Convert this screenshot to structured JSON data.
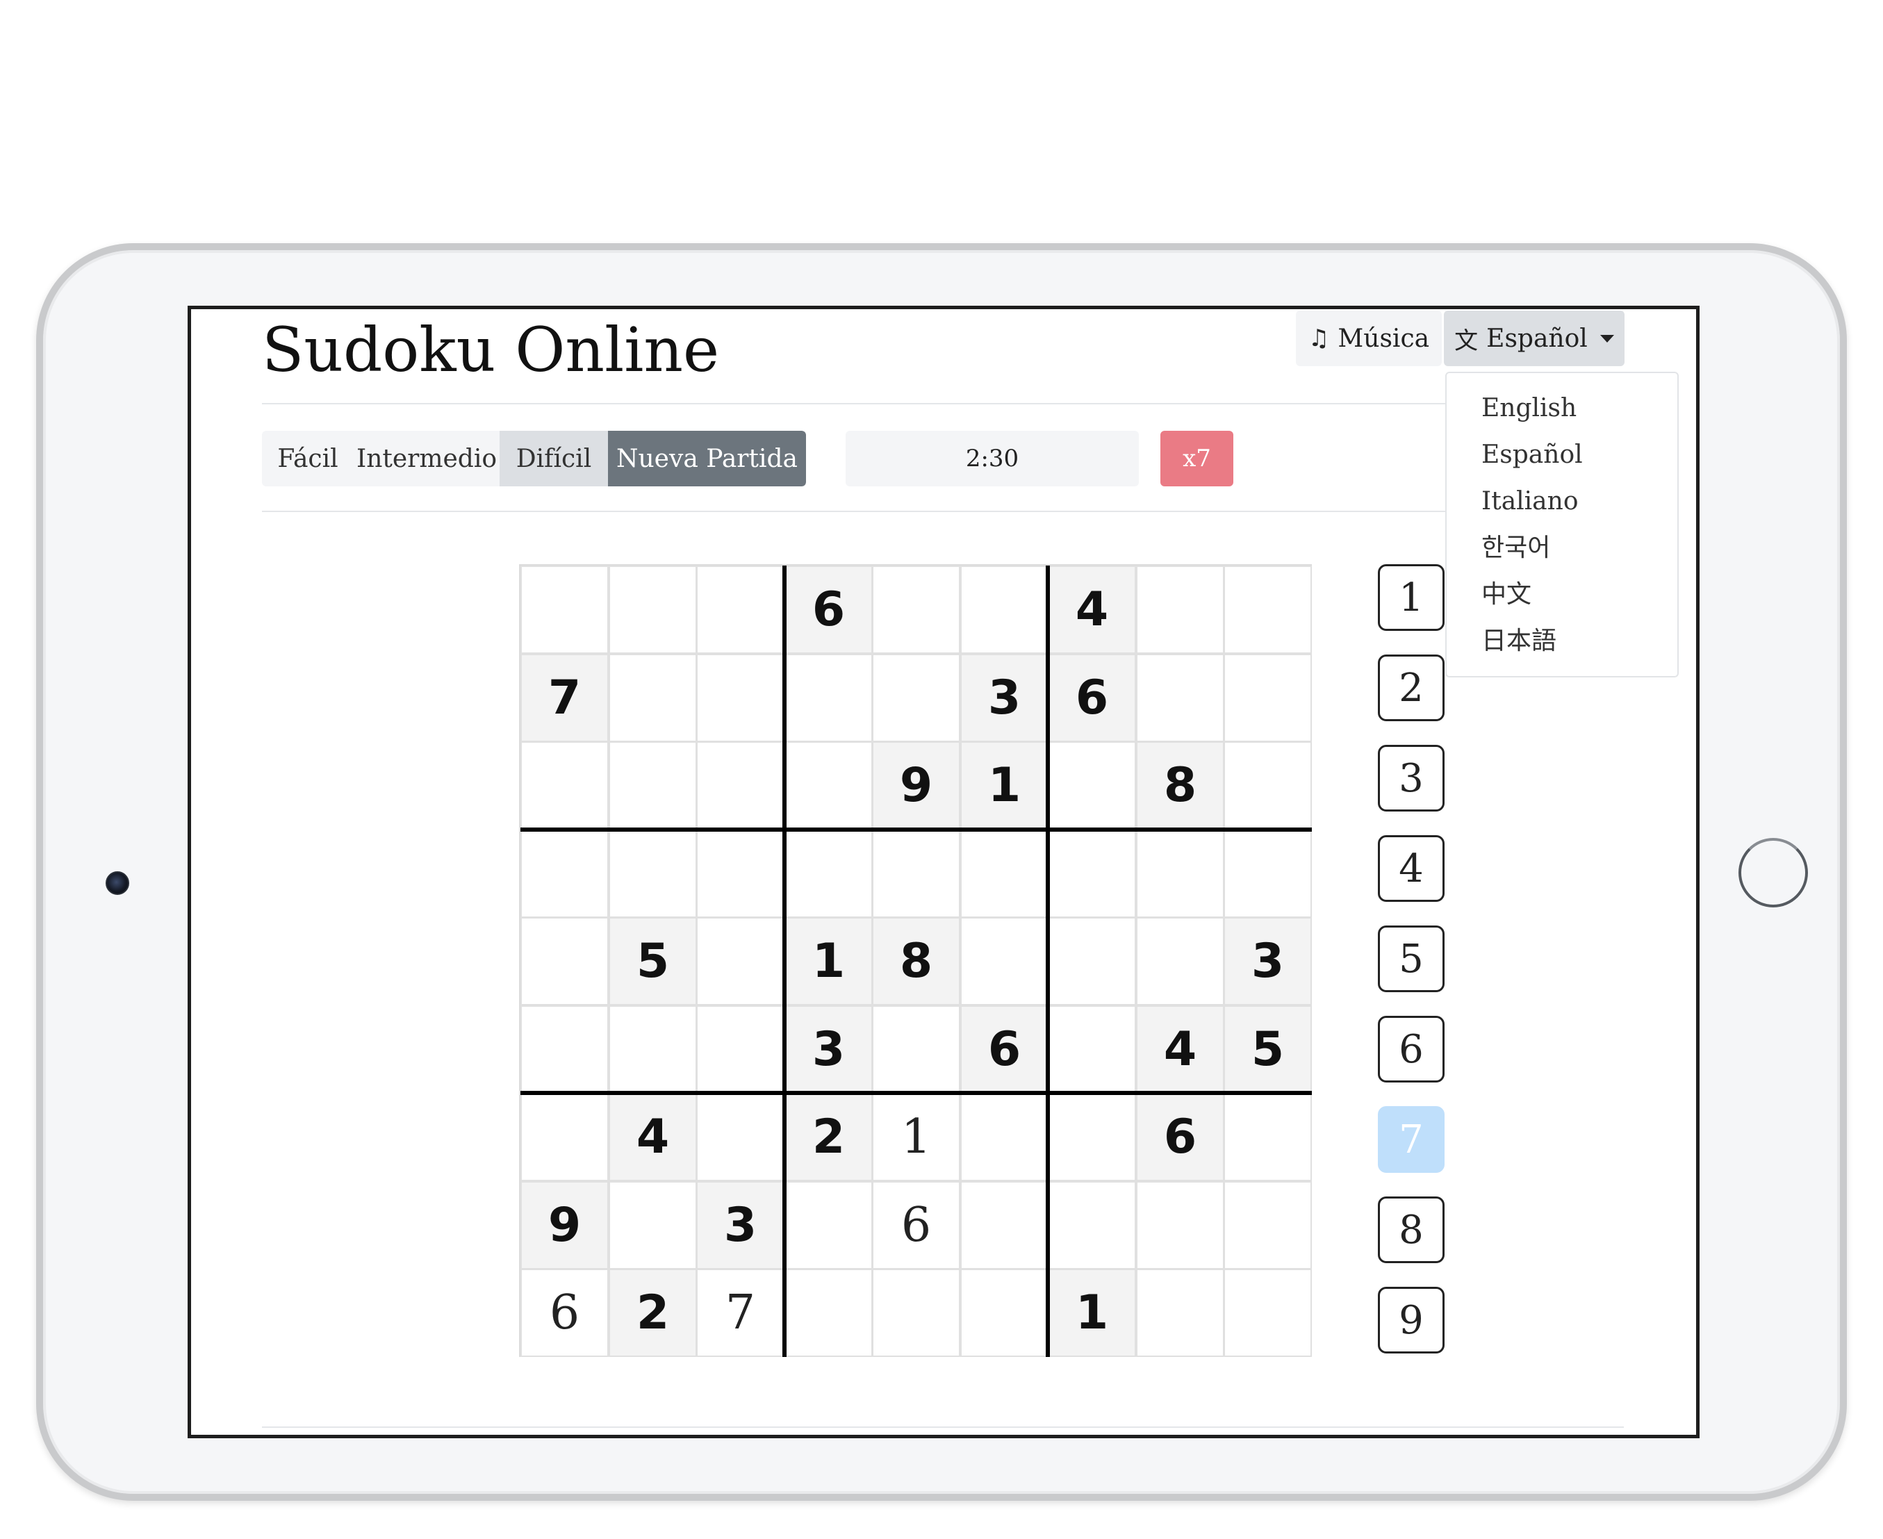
{
  "app": {
    "title": "Sudoku Online"
  },
  "header": {
    "music_label": "Música",
    "language_label": "Español"
  },
  "language_menu": {
    "items": [
      "English",
      "Español",
      "Italiano",
      "한국어",
      "中文",
      "日本語"
    ]
  },
  "toolbar": {
    "difficulty": [
      "Fácil",
      "Intermedio",
      "Difícil"
    ],
    "selected_difficulty": "Difícil",
    "new_game_label": "Nueva Partida",
    "timer": "2:30",
    "mistakes": "x7"
  },
  "board": {
    "rows": [
      [
        "",
        "",
        "",
        "6",
        "",
        "",
        "4",
        "",
        ""
      ],
      [
        "7",
        "",
        "",
        "",
        "",
        "3",
        "6",
        "",
        ""
      ],
      [
        "",
        "",
        "",
        "",
        "9",
        "1",
        "",
        "8",
        ""
      ],
      [
        "",
        "",
        "",
        "",
        "",
        "",
        "",
        "",
        ""
      ],
      [
        "",
        "5",
        "",
        "1",
        "8",
        "",
        "",
        "",
        "3"
      ],
      [
        "",
        "",
        "",
        "3",
        "",
        "6",
        "",
        "4",
        "5"
      ],
      [
        "",
        "4",
        "",
        "2",
        "1",
        "",
        "",
        "6",
        ""
      ],
      [
        "9",
        "",
        "3",
        "",
        "6",
        "",
        "",
        "",
        ""
      ],
      [
        "6",
        "2",
        "7",
        "",
        "",
        "",
        "1",
        "",
        ""
      ]
    ],
    "given": [
      [
        0,
        0,
        0,
        1,
        0,
        0,
        1,
        0,
        0
      ],
      [
        1,
        0,
        0,
        0,
        0,
        1,
        1,
        0,
        0
      ],
      [
        0,
        0,
        0,
        0,
        1,
        1,
        0,
        1,
        0
      ],
      [
        0,
        0,
        0,
        0,
        0,
        0,
        0,
        0,
        0
      ],
      [
        0,
        1,
        0,
        1,
        1,
        0,
        0,
        0,
        1
      ],
      [
        0,
        0,
        0,
        1,
        0,
        1,
        0,
        1,
        1
      ],
      [
        0,
        1,
        0,
        1,
        0,
        0,
        0,
        1,
        0
      ],
      [
        1,
        0,
        1,
        0,
        0,
        0,
        0,
        0,
        0
      ],
      [
        0,
        1,
        0,
        0,
        0,
        0,
        1,
        0,
        0
      ]
    ]
  },
  "number_pad": {
    "numbers": [
      "1",
      "2",
      "3",
      "4",
      "5",
      "6",
      "7",
      "8",
      "9"
    ],
    "selected": "7"
  },
  "icons": {
    "music": "music-note-icon",
    "language": "translate-icon",
    "dropdown": "caret-down-icon"
  },
  "colors": {
    "new_game_bg": "#6c757d",
    "mistakes_bg": "#ea7b85",
    "selected_number_bg": "#bfdffb",
    "given_cell_bg": "#f3f3f3"
  }
}
